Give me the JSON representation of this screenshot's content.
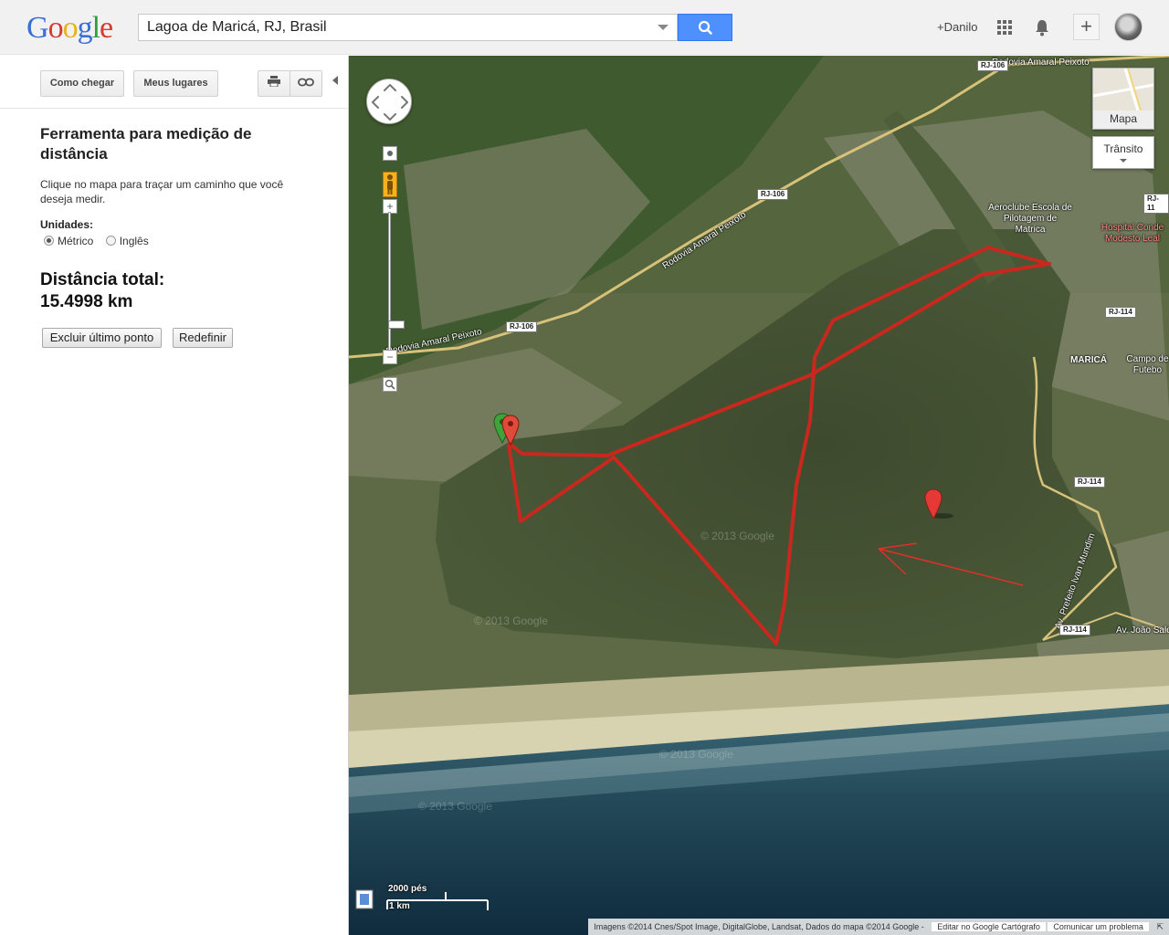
{
  "header": {
    "logo": "Google",
    "search_value": "Lagoa de Maricá, RJ, Brasil",
    "user_name": "+Danilo",
    "share_label": "+"
  },
  "sidebar": {
    "directions_label": "Como chegar",
    "my_places_label": "Meus lugares",
    "tool_title": "Ferramenta para medição de distância",
    "tool_desc": "Clique no mapa para traçar um caminho que você deseja medir.",
    "units_label": "Unidades:",
    "unit_metric": "Métrico",
    "unit_english": "Inglês",
    "selected_unit": "Métrico",
    "distance_label": "Distância total:",
    "distance_value": "15.4998 km",
    "delete_last_label": "Excluir último ponto",
    "reset_label": "Redefinir"
  },
  "map": {
    "map_type_label": "Mapa",
    "traffic_label": "Trânsito",
    "scale_imperial": "2000 pés",
    "scale_metric": "1 km",
    "labels": {
      "rodovia_amaral_top": "Rodovia Amaral Peixoto",
      "rodovia_amaral_mid": "Rodovia Amaral Peixoto",
      "rodovia_amaral_left": "Rodovia Amaral Peixoto",
      "avenida_prefeito": "Av. Prefeito Ivan Mundim",
      "avenida_joao": "Av. João Salda",
      "marica": "MARICÁ",
      "aeroclube": "Aeroclube Escola de Pilotagem de Matrica",
      "hospital": "Hospital Conde Modesto Leal",
      "campo": "Campo de Futebo"
    },
    "roads": {
      "rj106_top": "RJ-106",
      "rj106_mid": "RJ-106",
      "rj106_left": "RJ-106",
      "rj114_a": "RJ-114",
      "rj114_b": "RJ-114",
      "rj114_c": "RJ-114",
      "rj11x": "RJ-11"
    },
    "watermark": "© 2013 Google",
    "attribution": "Imagens ©2014 Cnes/Spot Image, DigitalGlobe, Landsat, Dados do mapa ©2014 Google -",
    "edit_link": "Editar no Google Cartógrafo",
    "report_link": "Comunicar um problema",
    "route_color": "#c8281e",
    "marker_color": "#e53935"
  }
}
